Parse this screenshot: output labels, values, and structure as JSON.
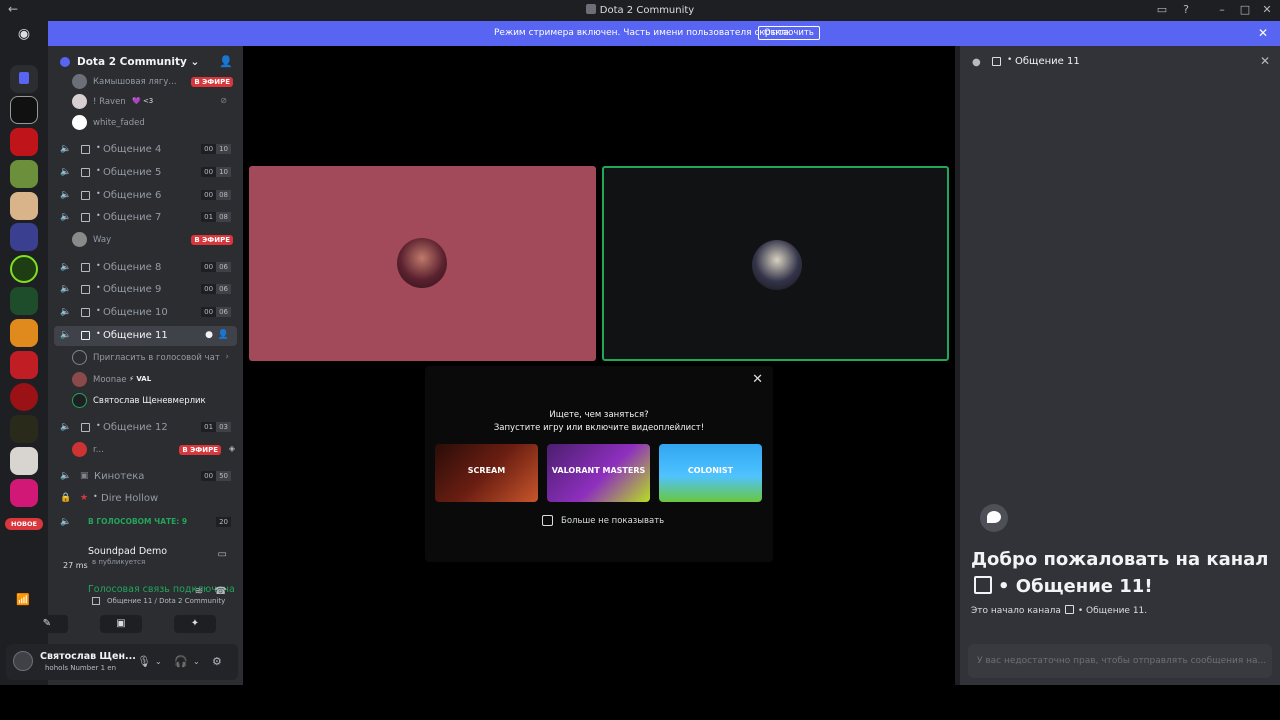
{
  "window": {
    "title": "Dota 2 Community"
  },
  "banner": {
    "text": "Режим стримера включен. Часть имени пользователя скрыта.",
    "button": "Отключить"
  },
  "servers": {
    "new_label": "НОВОЕ"
  },
  "guild": {
    "name": "Dota 2 Community"
  },
  "channels": {
    "top_users": [
      {
        "name": "Камышовая лягу...",
        "live": "В ЭФИРЕ"
      },
      {
        "name": "! Raven",
        "extra": "💜 <3"
      },
      {
        "name": "white_faded"
      }
    ],
    "voice": [
      {
        "name": "Общение 4",
        "c1": "00",
        "c2": "10"
      },
      {
        "name": "Общение 5",
        "c1": "00",
        "c2": "10"
      },
      {
        "name": "Общение 6",
        "c1": "00",
        "c2": "08"
      },
      {
        "name": "Общение 7",
        "c1": "01",
        "c2": "08"
      },
      {
        "name": "Общение 8",
        "c1": "00",
        "c2": "06"
      },
      {
        "name": "Общение 9",
        "c1": "00",
        "c2": "06"
      },
      {
        "name": "Общение 10",
        "c1": "00",
        "c2": "06"
      },
      {
        "name": "Общение 11"
      },
      {
        "name": "Общение 12",
        "c1": "01",
        "c2": "03"
      },
      {
        "name": "Кинотека",
        "c1": "00",
        "c2": "50"
      },
      {
        "name": "Dire Hollow"
      }
    ],
    "way": {
      "name": "Way",
      "live": "В ЭФИРЕ"
    },
    "invite": "Пригласить в голосовой чат",
    "moonae": {
      "name": "Moonae",
      "tag": "⚡ VAL"
    },
    "svyat": "Святослав Щеневмерлик",
    "r": {
      "name": "r...",
      "live": "В ЭФИРЕ"
    },
    "in_voice": {
      "label": "В ГОЛОСОВОМ ЧАТЕ: 9",
      "count": "20"
    }
  },
  "voice_panel": {
    "soundpad": "Soundpad Demo",
    "soundpad_sub": "в публикуется",
    "ping": "27 ms",
    "connected": "Голосовая связь подключена",
    "connected_sub": "Общение 11 / Dota 2 Community"
  },
  "user": {
    "name": "Святослав Щен...",
    "status": "hohols Number 1 en"
  },
  "popup": {
    "q1": "Ищете, чем заняться?",
    "q2": "Запустите игру или включите видеоплейлист!",
    "cards": [
      "SCREAM",
      "VALORANT MASTERS",
      "COLONIST"
    ],
    "checkbox": "Больше не показывать"
  },
  "chat": {
    "channel_name": "Общение 11",
    "welcome1": "Добро пожаловать на канал",
    "welcome2": "Общение 11!",
    "start_prefix": "Это начало канала",
    "start_channel": "Общение 11.",
    "placeholder": "У вас недостаточно прав, чтобы отправлять сообщения на..."
  },
  "colors": {
    "accent": "#5865f2",
    "live": "#da373c",
    "online": "#23a55a"
  }
}
